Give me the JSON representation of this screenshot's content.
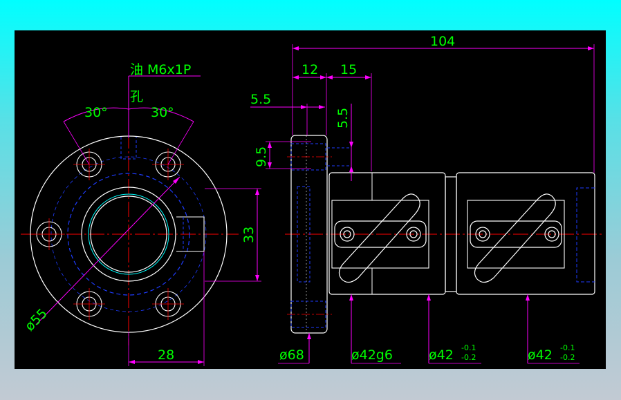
{
  "colors": {
    "outline": "#ffffff",
    "dimension": "#ff00ff",
    "text": "#00ff00",
    "hidden": "#1e3cff",
    "center": "#ff0000",
    "cyan_accent": "#00ffff"
  },
  "front_view": {
    "oil_hole_label_line1": "油 M6x1P",
    "oil_hole_label_line2": "孔",
    "angle_left": "30°",
    "angle_right": "30°",
    "dim_33": "33",
    "dim_28": "28",
    "dia_55": "ø55"
  },
  "side_view": {
    "dim_104": "104",
    "dim_12": "12",
    "dim_15": "15",
    "dim_5_5_h": "5.5",
    "dim_5_5_v": "5.5",
    "dim_9_5": "9.5",
    "dia_68": "ø68",
    "dia_42g6": "ø42g6",
    "dia_42_a": "ø42",
    "tol_a_upper": "-0.1",
    "tol_a_lower": "-0.2",
    "dia_42_b": "ø42",
    "tol_b_upper": "-0.1",
    "tol_b_lower": "-0.2"
  }
}
